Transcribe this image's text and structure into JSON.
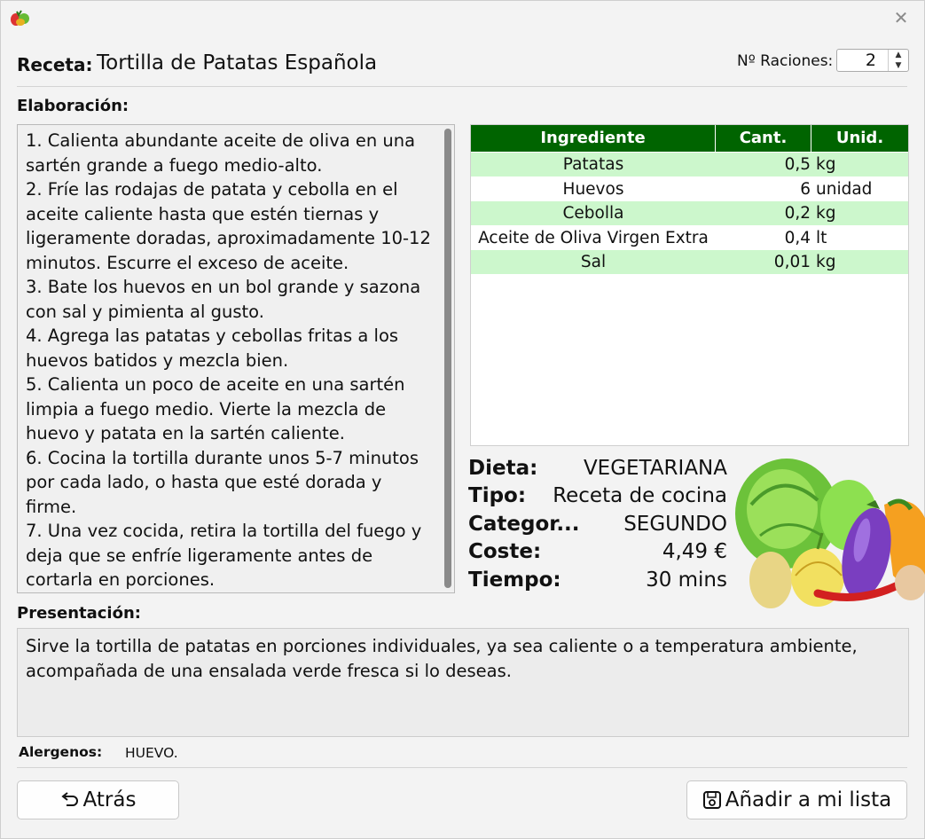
{
  "header": {
    "recipe_label": "Receta:",
    "recipe_title": "Tortilla de Patatas Española",
    "servings_label": "Nº Raciones:",
    "servings_value": "2"
  },
  "elaboration": {
    "label": "Elaboración:",
    "text": "1. Calienta abundante aceite de oliva en una sartén grande a fuego medio-alto.\n2. Fríe las rodajas de patata y cebolla en el aceite caliente hasta que estén tiernas y ligeramente doradas, aproximadamente 10-12 minutos. Escurre el exceso de aceite.\n3. Bate los huevos en un bol grande y sazona con sal y pimienta al gusto.\n4. Agrega las patatas y cebollas fritas a los huevos batidos y mezcla bien.\n5. Calienta un poco de aceite en una sartén limpia a fuego medio. Vierte la mezcla de huevo y patata en la sartén caliente.\n6. Cocina la tortilla durante unos 5-7 minutos por cada lado, o hasta que esté dorada y firme.\n7. Una vez cocida, retira la tortilla del fuego y deja que se enfríe ligeramente antes de cortarla en porciones."
  },
  "ingredients": {
    "columns": [
      "Ingrediente",
      "Cant.",
      "Unid."
    ],
    "rows": [
      {
        "name": "Patatas",
        "qty": "0,5",
        "unit": "kg"
      },
      {
        "name": "Huevos",
        "qty": "6",
        "unit": "unidad"
      },
      {
        "name": "Cebolla",
        "qty": "0,2",
        "unit": "kg"
      },
      {
        "name": "Aceite de Oliva Virgen Extra",
        "qty": "0,4",
        "unit": "lt"
      },
      {
        "name": "Sal",
        "qty": "0,01",
        "unit": "kg"
      }
    ],
    "header_color": "#006400",
    "alt_row_color": "#ccf7cc"
  },
  "info": {
    "diet_label": "Dieta:",
    "diet_value": "VEGETARIANA",
    "type_label": "Tipo:",
    "type_value": "Receta de cocina",
    "category_label": "Categor...",
    "category_value": "SEGUNDO",
    "cost_label": "Coste:",
    "cost_value": "4,49 €",
    "time_label": "Tiempo:",
    "time_value": "30 mins"
  },
  "presentation": {
    "label": "Presentación:",
    "text": "Sirve la tortilla de patatas en porciones individuales, ya sea caliente o a temperatura ambiente, acompañada de una ensalada verde fresca si lo deseas."
  },
  "allergens": {
    "label": "Alergenos:",
    "value": "HUEVO."
  },
  "buttons": {
    "back_label": "Atrás",
    "back_icon": "undo-arrow-icon",
    "add_label": "Añadir a mi lista",
    "add_icon": "save-disk-icon"
  },
  "window": {
    "close_icon": "close-icon",
    "app_icon": "vegetables-app-icon"
  }
}
